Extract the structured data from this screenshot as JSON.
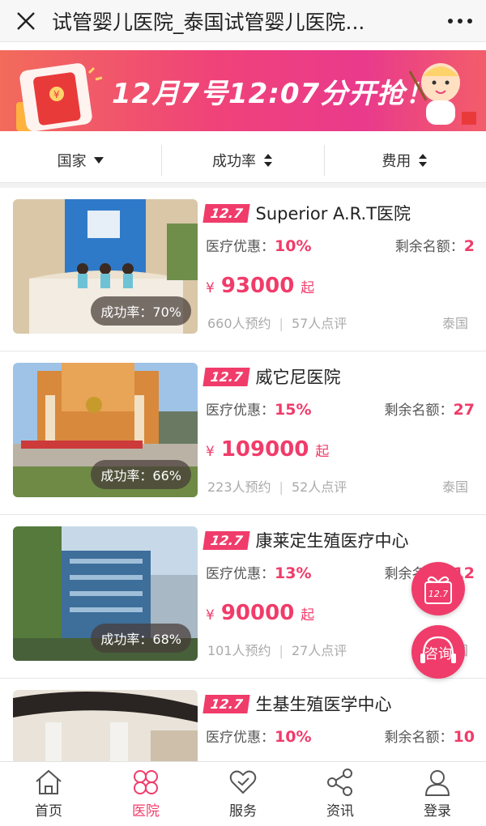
{
  "header": {
    "title": "试管婴儿医院_泰国试管婴儿医院..."
  },
  "banner": {
    "text": "12月7号12:07分开抢！"
  },
  "filters": [
    {
      "label": "国家"
    },
    {
      "label": "成功率"
    },
    {
      "label": "费用"
    }
  ],
  "labels": {
    "discount": "医疗优惠：",
    "remaining": "剩余名额：",
    "yen": "¥",
    "qi": "起",
    "divider": "|"
  },
  "hospitals": [
    {
      "badge": "12.7",
      "name": "Superior A.R.T医院",
      "discount": "10%",
      "remaining": "2",
      "price": "93000",
      "success_rate": "成功率：70%",
      "bookings": "660人预约",
      "reviews": "57人点评",
      "country": "泰国"
    },
    {
      "badge": "12.7",
      "name": "威它尼医院",
      "discount": "15%",
      "remaining": "27",
      "price": "109000",
      "success_rate": "成功率：66%",
      "bookings": "223人预约",
      "reviews": "52人点评",
      "country": "泰国"
    },
    {
      "badge": "12.7",
      "name": "康莱定生殖医疗中心",
      "discount": "13%",
      "remaining": "12",
      "price": "90000",
      "success_rate": "成功率：68%",
      "bookings": "101人预约",
      "reviews": "27人点评",
      "country": "泰国"
    },
    {
      "badge": "12.7",
      "name": "生基生殖医学中心",
      "discount": "10%",
      "remaining": "10"
    }
  ],
  "floating": {
    "gift_label": "12.7",
    "consult_label": "咨询"
  },
  "nav": [
    {
      "label": "首页"
    },
    {
      "label": "医院"
    },
    {
      "label": "服务"
    },
    {
      "label": "资讯"
    },
    {
      "label": "登录"
    }
  ],
  "colors": {
    "accent": "#f03c6a",
    "text": "#333333",
    "muted": "#aaaaaa"
  }
}
